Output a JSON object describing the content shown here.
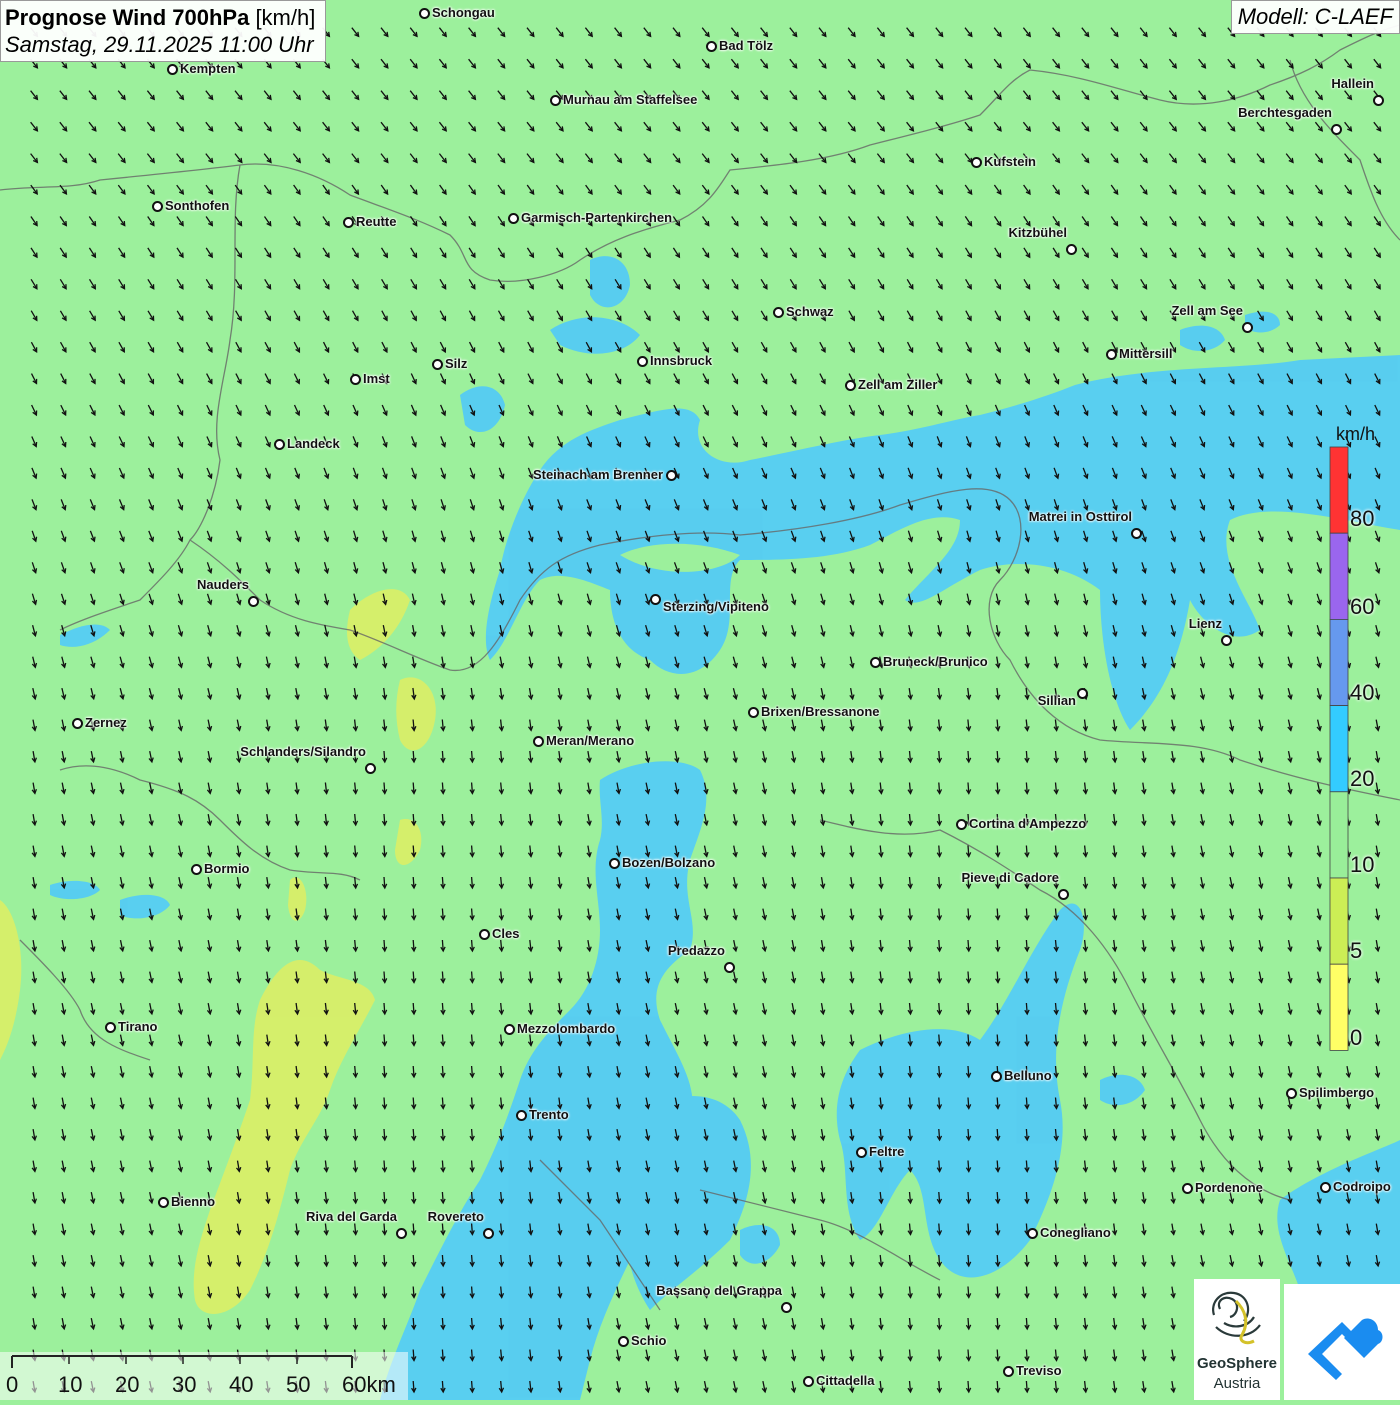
{
  "header": {
    "title_bold": "Prognose Wind 700hPa",
    "title_unit": "[km/h]",
    "subtitle": "Samstag, 29.11.2025 11:00 Uhr",
    "model": "Modell: C-LAEF"
  },
  "legend": {
    "unit": "km/h",
    "labels": [
      "80",
      "60",
      "40",
      "20",
      "10",
      "5",
      "0"
    ],
    "colors": [
      "#ff3333",
      "#9a66ee",
      "#6699ee",
      "#33ccff",
      "#99ee99",
      "#ccee55",
      "#ffff66"
    ]
  },
  "scale": {
    "labels": [
      "0",
      "10",
      "20",
      "30",
      "40",
      "50",
      "60km"
    ]
  },
  "logo": {
    "line1": "GeoSphere",
    "line2": "Austria"
  },
  "colors": {
    "background": "#9cf09c",
    "wind_20_40": "#55ccf4",
    "wind_5_10": "#dcee66"
  },
  "cities": [
    {
      "name": "Schongau"
    },
    {
      "name": "Kempten"
    },
    {
      "name": "Bad Tölz"
    },
    {
      "name": "Murnau am Staffelsee"
    },
    {
      "name": "Hallein"
    },
    {
      "name": "Berchtesgaden"
    },
    {
      "name": "Kufstein"
    },
    {
      "name": "Sonthofen"
    },
    {
      "name": "Reutte"
    },
    {
      "name": "Garmisch-Partenkirchen"
    },
    {
      "name": "Kitzbühel"
    },
    {
      "name": "Schwaz"
    },
    {
      "name": "Zell am See"
    },
    {
      "name": "Innsbruck"
    },
    {
      "name": "Mittersill"
    },
    {
      "name": "Silz"
    },
    {
      "name": "Imst"
    },
    {
      "name": "Zell am Ziller"
    },
    {
      "name": "Landeck"
    },
    {
      "name": "Steinach am Brenner"
    },
    {
      "name": "Matrei in Osttirol"
    },
    {
      "name": "Nauders"
    },
    {
      "name": "Sterzing/Vipiteno"
    },
    {
      "name": "Lienz"
    },
    {
      "name": "Bruneck/Brunico"
    },
    {
      "name": "Sillian"
    },
    {
      "name": "Brixen/Bressanone"
    },
    {
      "name": "Zernez"
    },
    {
      "name": "Meran/Merano"
    },
    {
      "name": "Schlanders/Silandro"
    },
    {
      "name": "Cortina d'Ampezzo"
    },
    {
      "name": "Bozen/Bolzano"
    },
    {
      "name": "Bormio"
    },
    {
      "name": "Pieve di Cadore"
    },
    {
      "name": "Cles"
    },
    {
      "name": "Predazzo"
    },
    {
      "name": "Tirano"
    },
    {
      "name": "Mezzolombardo"
    },
    {
      "name": "Belluno"
    },
    {
      "name": "Spilimbergo"
    },
    {
      "name": "Trento"
    },
    {
      "name": "Feltre"
    },
    {
      "name": "Pordenone"
    },
    {
      "name": "Codroipo"
    },
    {
      "name": "Bienno"
    },
    {
      "name": "Riva del Garda"
    },
    {
      "name": "Rovereto"
    },
    {
      "name": "Conegliano"
    },
    {
      "name": "Bassano del Grappa"
    },
    {
      "name": "Schio"
    },
    {
      "name": "Treviso"
    },
    {
      "name": "Cittadella"
    }
  ]
}
